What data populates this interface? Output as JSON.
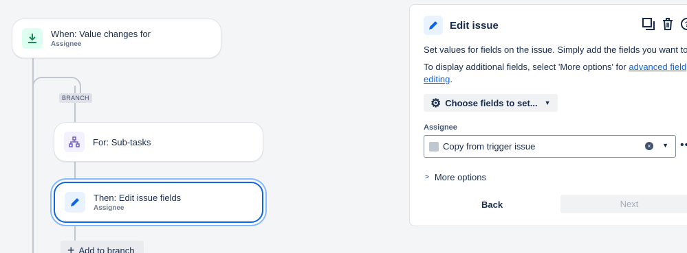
{
  "flow": {
    "trigger": {
      "title": "When: Value changes for",
      "subtitle": "Assignee",
      "icon": "download-arrow-icon"
    },
    "branch_label": "BRANCH",
    "branch_node": {
      "title": "For: Sub-tasks",
      "icon": "hierarchy-icon"
    },
    "action_node": {
      "title": "Then: Edit issue fields",
      "subtitle": "Assignee",
      "icon": "pencil-icon"
    },
    "add_label": "Add to branch"
  },
  "panel": {
    "title": "Edit issue",
    "desc1": "Set values for fields on the issue. Simply add the fields you want to ed",
    "desc2_prefix": "To display additional fields, select 'More options' for",
    "desc2_link_a": "advanced field",
    "desc2_link_b": "editing",
    "desc2_suffix": ".",
    "choose_label": "Choose fields to set...",
    "field_label": "Assignee",
    "field_value": "Copy from trigger issue",
    "more_options": "More options",
    "back": "Back",
    "next": "Next"
  },
  "colors": {
    "accent": "#0c66e4",
    "trigger_icon_bg": "#dcfff1",
    "trigger_icon": "#1f845a",
    "branch_icon_bg": "#f3f0ff",
    "branch_icon": "#6e5dc6"
  }
}
